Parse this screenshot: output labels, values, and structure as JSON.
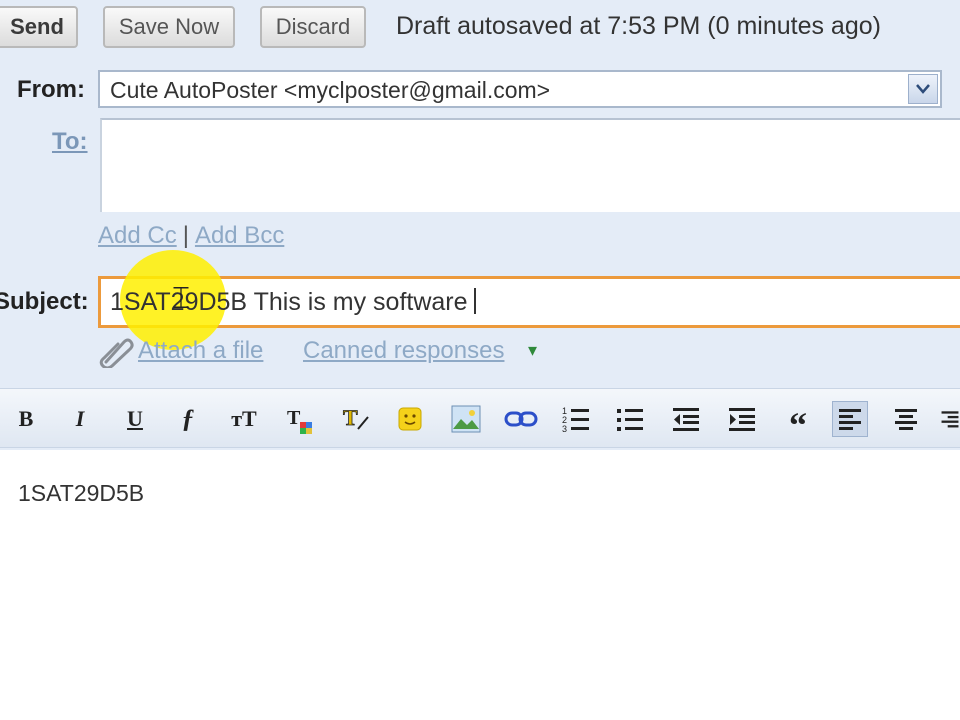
{
  "toolbar": {
    "send_label": "Send",
    "save_label": "Save Now",
    "discard_label": "Discard",
    "status": "Draft autosaved at 7:53 PM (0 minutes ago)"
  },
  "compose": {
    "from_label": "From:",
    "from_value": "Cute AutoPoster <myclposter@gmail.com>",
    "to_label": "To:",
    "to_value": "",
    "add_cc": "Add Cc",
    "cc_separator": "|",
    "add_bcc": "Add Bcc",
    "subject_label": "Subject:",
    "subject_value": "1SAT29D5B This is my software",
    "attach_label": "Attach a file",
    "canned_label": "Canned responses",
    "canned_arrow": "▾"
  },
  "format_toolbar": {
    "bold": "B",
    "italic": "I",
    "underline": "U",
    "font": "ƒ",
    "size": "тT",
    "quote": "“"
  },
  "body": {
    "text": "1SAT29D5B"
  }
}
